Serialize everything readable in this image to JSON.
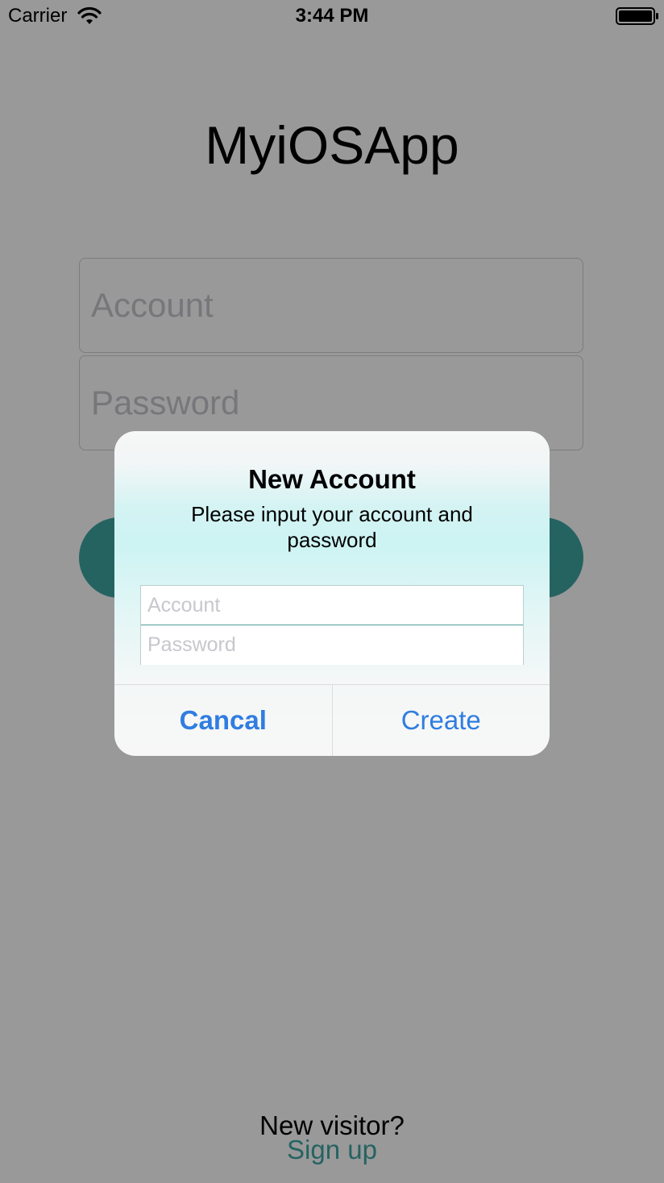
{
  "status_bar": {
    "carrier": "Carrier",
    "time": "3:44 PM",
    "wifi_icon": "wifi-icon",
    "battery_icon": "battery-icon"
  },
  "login": {
    "app_title": "MyiOSApp",
    "account_placeholder": "Account",
    "password_placeholder": "Password",
    "button_color": "#3fa6a2",
    "visitor_text": "New visitor?",
    "signup_label": "Sign up",
    "signup_color": "#3fa6a2"
  },
  "alert": {
    "title": "New Account",
    "message": "Please input your account and password",
    "account_placeholder": "Account",
    "password_placeholder": "Password",
    "cancel_label": "Cancal",
    "create_label": "Create",
    "button_color": "#2f7de1"
  }
}
